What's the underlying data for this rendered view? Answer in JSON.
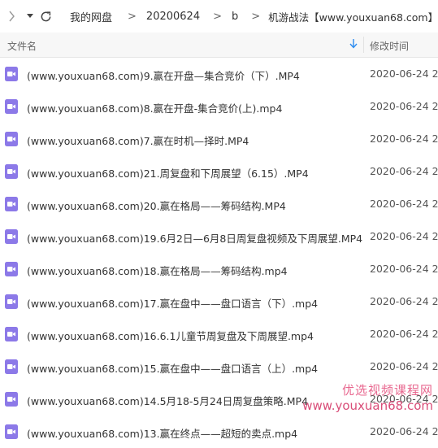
{
  "breadcrumb": {
    "items": [
      "我的网盘",
      "20200624",
      "b",
      "机游战法【www.youxuan68.com】"
    ],
    "separator": ">"
  },
  "header": {
    "name_label": "文件名",
    "time_label": "修改时间",
    "sort_icon": "arrow-down-icon"
  },
  "files": [
    {
      "name": "(www.youxuan68.com)9.赢在开盘—集合竞价（下）.MP4",
      "date": "2020-06-24 20"
    },
    {
      "name": "(www.youxuan68.com)8.赢在开盘-集合竞价(上).mp4",
      "date": "2020-06-24 20"
    },
    {
      "name": "(www.youxuan68.com)7.赢在时机—择时.MP4",
      "date": "2020-06-24 20"
    },
    {
      "name": "(www.youxuan68.com)21.周复盘和下周展望（6.15）.MP4",
      "date": "2020-06-24 20"
    },
    {
      "name": "(www.youxuan68.com)20.赢在格局——筹码结构.MP4",
      "date": "2020-06-24 20"
    },
    {
      "name": "(www.youxuan68.com)19.6月2日—6月8日周复盘视频及下周展望.MP4",
      "date": "2020-06-24 20"
    },
    {
      "name": "(www.youxuan68.com)18.赢在格局——筹码结构.mp4",
      "date": "2020-06-24 20"
    },
    {
      "name": "(www.youxuan68.com)17.赢在盘中——盘口语言（下）.mp4",
      "date": "2020-06-24 20"
    },
    {
      "name": "(www.youxuan68.com)16.6.1儿童节周复盘及下周展望.mp4",
      "date": "2020-06-24 20"
    },
    {
      "name": "(www.youxuan68.com)15.赢在盘中——盘口语言（上）.mp4",
      "date": "2020-06-24 20"
    },
    {
      "name": "(www.youxuan68.com)14.5月18-5月24日周复盘策略.MP4",
      "date": "2020-06-24 20"
    },
    {
      "name": "(www.youxuan68.com)13.赢在终点——超短的卖点.mp4",
      "date": "2020-06-24 20"
    }
  ],
  "watermark": {
    "line1": "优选视频课程网",
    "line2": "www.youxuan68.com"
  },
  "colors": {
    "video_icon": "#8c79e8",
    "sort_arrow": "#2d8cf0",
    "watermark": "#e8678f"
  }
}
